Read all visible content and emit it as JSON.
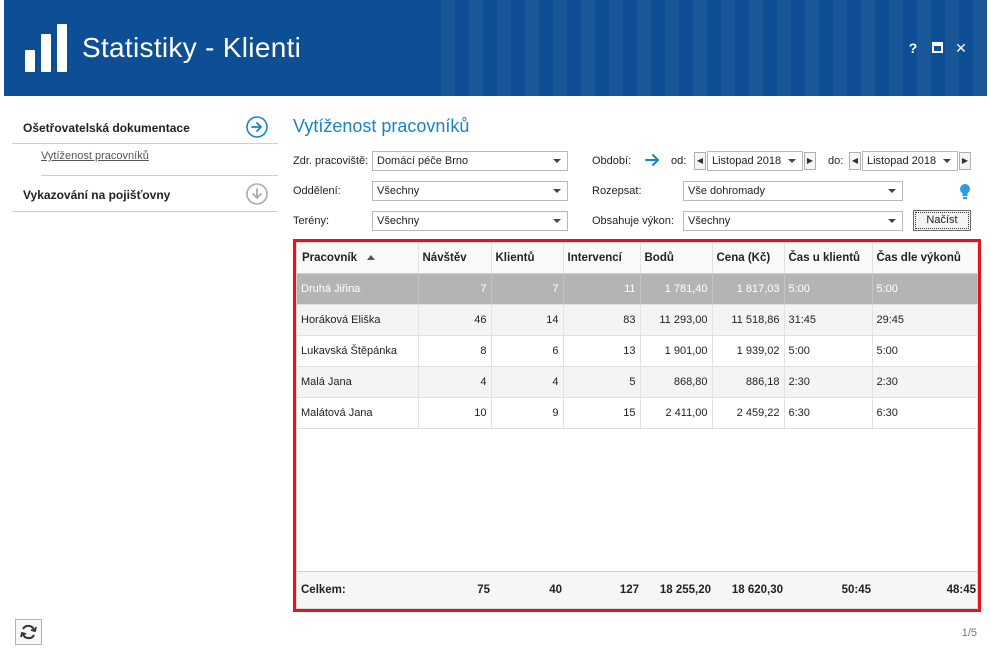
{
  "app": {
    "title": "Statistiky - Klienti",
    "help_label": "?",
    "close_label": "✕",
    "brand_color": "#0d4e94",
    "accent_color": "#1a82c7"
  },
  "sidebar": {
    "sections": [
      {
        "label": "Ošetřovatelská dokumentace",
        "icon": "arrow-right-circle-icon",
        "items": [
          {
            "label": "Vytíženost pracovníků"
          }
        ]
      },
      {
        "label": "Vykazování na pojišťovny",
        "icon": "arrow-down-circle-icon"
      }
    ]
  },
  "page": {
    "title": "Vytíženost pracovníků"
  },
  "filters": {
    "workplace": {
      "label": "Zdr. pracoviště:",
      "value": "Domácí péče Brno"
    },
    "department": {
      "label": "Oddělení:",
      "value": "Všechny"
    },
    "terrains": {
      "label": "Terény:",
      "value": "Všechny"
    },
    "period": {
      "label": "Období:",
      "from_label": "od:",
      "from_value": "Listopad 2018",
      "to_label": "do:",
      "to_value": "Listopad 2018"
    },
    "breakdown": {
      "label": "Rozepsat:",
      "value": "Vše dohromady"
    },
    "contains": {
      "label": "Obsahuje výkon:",
      "value": "Všechny"
    },
    "load_button": "Načíst"
  },
  "grid": {
    "columns": [
      "Pracovník",
      "Návštěv",
      "Klientů",
      "Intervencí",
      "Bodů",
      "Cena (Kč)",
      "Čas u klientů",
      "Čas dle výkonů"
    ],
    "rows": [
      [
        "Druhá Jiřina",
        "7",
        "7",
        "11",
        "1 781,40",
        "1 817,03",
        "5:00",
        "5:00"
      ],
      [
        "Horáková Eliška",
        "46",
        "14",
        "83",
        "11 293,00",
        "11 518,86",
        "31:45",
        "29:45"
      ],
      [
        "Lukavská Štěpánka",
        "8",
        "6",
        "13",
        "1 901,00",
        "1 939,02",
        "5:00",
        "5:00"
      ],
      [
        "Malá Jana",
        "4",
        "4",
        "5",
        "868,80",
        "886,18",
        "2:30",
        "2:30"
      ],
      [
        "Malátová Jana",
        "10",
        "9",
        "15",
        "2 411,00",
        "2 459,22",
        "6:30",
        "6:30"
      ]
    ],
    "selected_row": 0,
    "totals": {
      "label": "Celkem:",
      "visits": "75",
      "clients": "40",
      "interventions": "127",
      "points": "18 255,20",
      "price": "18 620,30",
      "time_clients": "50:45",
      "time_services": "48:45"
    }
  },
  "pager": {
    "text": "1/5"
  }
}
